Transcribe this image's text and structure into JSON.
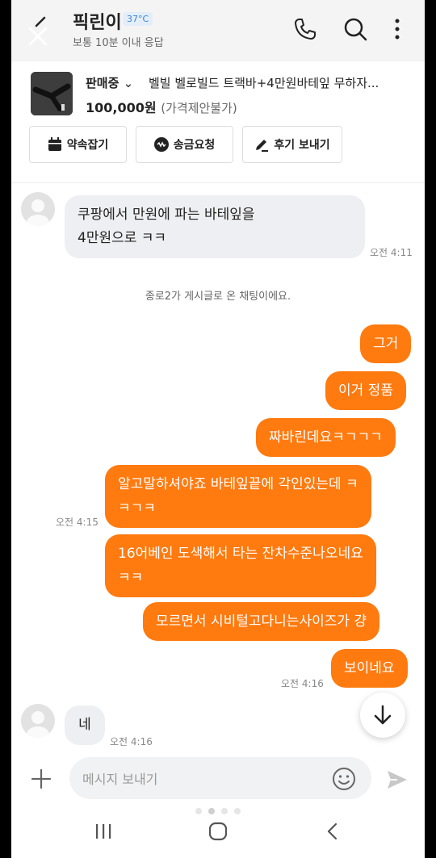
{
  "header": {
    "seller_name": "픽린이",
    "temperature": "37°C",
    "response_time": "보통 10분 이내 응답"
  },
  "product": {
    "status": "판매중",
    "title": "벨빌 벨로빌드 트랙바+4만원바테잎 무하자...",
    "price": "100,000원",
    "price_note": "(가격제안불가)"
  },
  "actions": {
    "appointment": "약속잡기",
    "money_request": "송금요청",
    "review": "후기 보내기"
  },
  "messages": {
    "in_1": [
      "쿠팡에서 만원에 파는 바테잎을",
      "4만원으로 ㅋㅋ"
    ],
    "in_1_time": "오전 4:11",
    "system": "종로2가 게시글로 온 채팅이에요.",
    "out_1": "그거",
    "out_2": "이거 정품",
    "out_3": "짜바린데요ㅋㄱㄱㄱ",
    "out_4": [
      "알고말하셔야죠 바테잎끝에 각인있는데 ㅋ",
      "ㅋㄱㅋ"
    ],
    "out_4_time": "오전 4:15",
    "out_5": [
      "16어베인 도색해서 타는 잔차수준나오네요",
      "ㅋㅋ"
    ],
    "out_6": "모르면서 시비털고다니는사이즈가 걍",
    "out_7": "보이네요",
    "out_7_time": "오전 4:16",
    "in_2": "네",
    "in_2_time": "오전 4:16"
  },
  "input": {
    "placeholder": "메시지 보내기"
  },
  "colors": {
    "accent": "#ff7a0f",
    "incoming_bubble": "#eeeff2"
  }
}
